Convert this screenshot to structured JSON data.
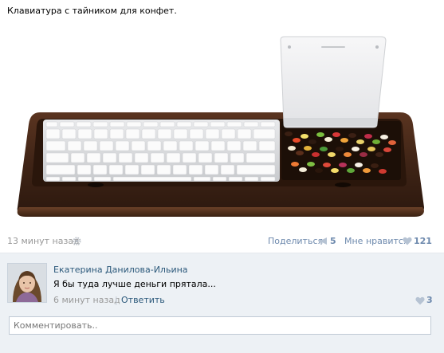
{
  "post": {
    "text": "Клавиатура с тайником для конфет.",
    "time": "13 минут назад",
    "share_label": "Поделиться",
    "share_count": "5",
    "like_label": "Мне нравится",
    "like_count": "121"
  },
  "comment": {
    "author": "Екатерина Данилова-Ильина",
    "text": "Я бы туда лучше деньги прятала...",
    "time": "6 минут назад",
    "separator": "|",
    "reply_label": "Ответить",
    "like_count": "3"
  },
  "composer": {
    "placeholder": "Комментировать.."
  },
  "colors": {
    "link": "#2b587a",
    "muted": "#999999",
    "accent": "#6d89ad",
    "comment_bg": "#edf1f5"
  }
}
